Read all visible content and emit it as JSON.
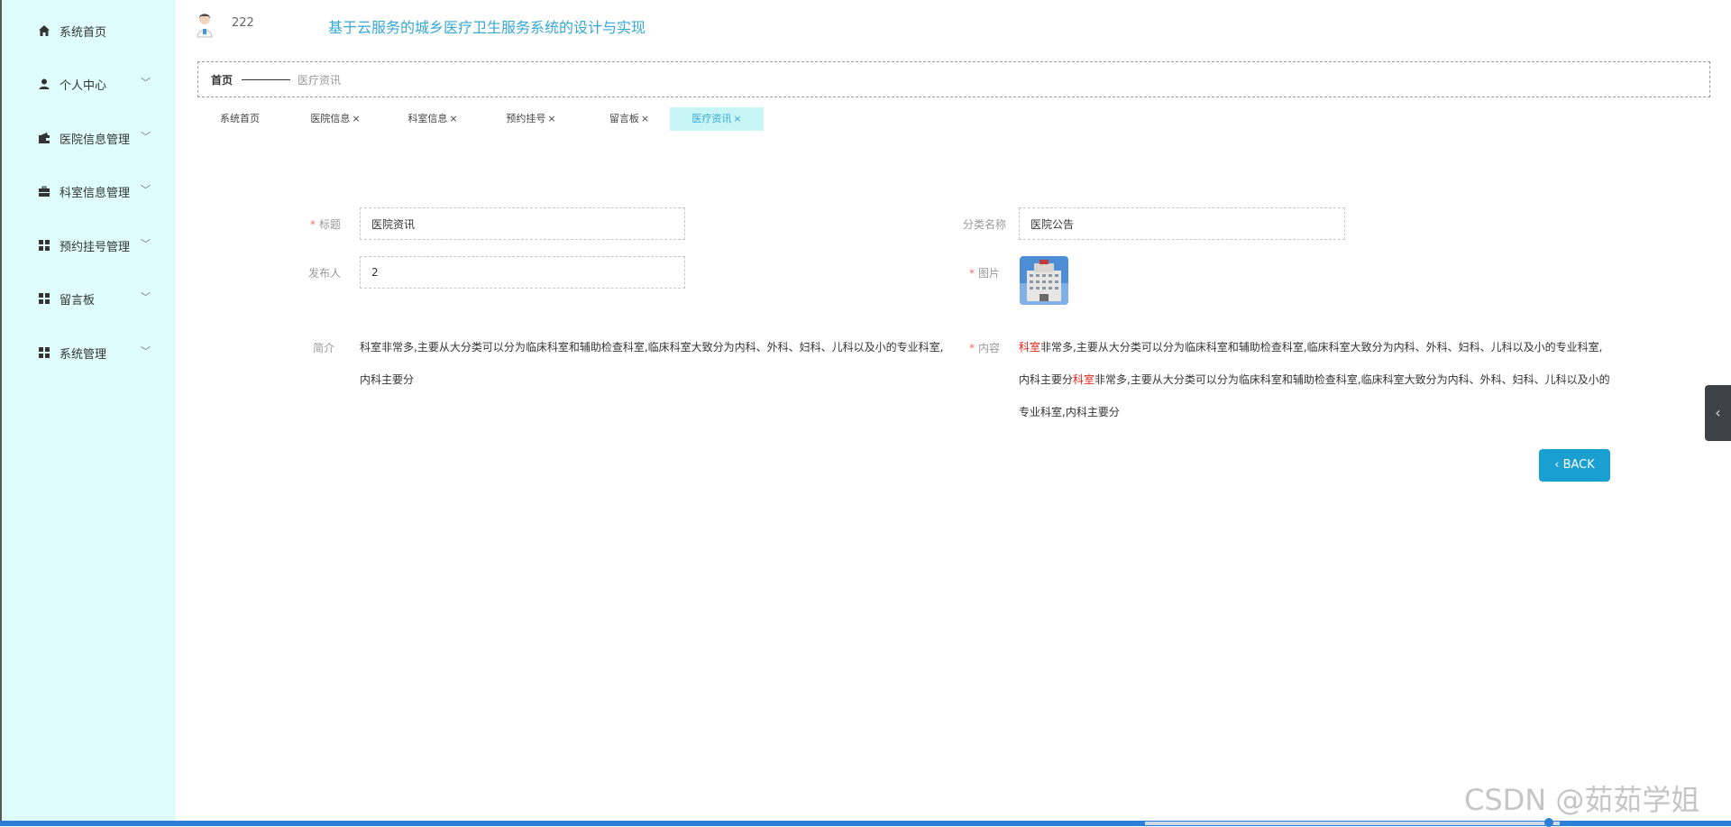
{
  "sidebar": {
    "items": [
      {
        "label": "系统首页",
        "icon": "home-icon"
      },
      {
        "label": "个人中心",
        "icon": "person-icon"
      },
      {
        "label": "医院信息管理",
        "icon": "wallet-icon"
      },
      {
        "label": "科室信息管理",
        "icon": "briefcase-icon"
      },
      {
        "label": "预约挂号管理",
        "icon": "grid-icon"
      },
      {
        "label": "留言板",
        "icon": "grid-icon"
      },
      {
        "label": "系统管理",
        "icon": "grid-icon"
      }
    ]
  },
  "header": {
    "username": "222",
    "title": "基于云服务的城乡医疗卫生服务系统的设计与实现"
  },
  "breadcrumb": {
    "home": "首页",
    "current": "医疗资讯"
  },
  "tabs": [
    {
      "label": "系统首页",
      "close": ""
    },
    {
      "label": "医院信息",
      "close": "×"
    },
    {
      "label": "科室信息",
      "close": "×"
    },
    {
      "label": "预约挂号",
      "close": "×"
    },
    {
      "label": "留言板",
      "close": "×"
    },
    {
      "label": "医疗资讯",
      "close": "×"
    }
  ],
  "form": {
    "title_label": "标题",
    "title_value": "医院资讯",
    "category_label": "分类名称",
    "category_value": "医院公告",
    "publisher_label": "发布人",
    "publisher_value": "2",
    "image_label": "图片",
    "intro_label": "简介",
    "intro_text": "科室非常多,主要从大分类可以分为临床科室和辅助检查科室,临床科室大致分为内科、外科、妇科、儿科以及小的专业科室,内科主要分",
    "content_label": "内容",
    "content_hl1": "科室",
    "content_part1": "非常多,主要从大分类可以分为临床科室和辅助检查科室,临床科室大致分为内科、外科、妇科、儿科以及小的专业科室,内科主要分",
    "content_hl2": "科室",
    "content_part2": "非常多,主要从大分类可以分为临床科室和辅助检查科室,临床科室大致分为内科、外科、妇科、儿科以及小的专业科室,内科主要分",
    "required_mark": "*"
  },
  "back_button": "BACK",
  "watermark": "CSDN @茹茹学姐",
  "colors": {
    "sidebar_bg": "#dffdfd",
    "accent": "#35a8d8",
    "button": "#1a9fd1",
    "required": "#f56c6c"
  }
}
